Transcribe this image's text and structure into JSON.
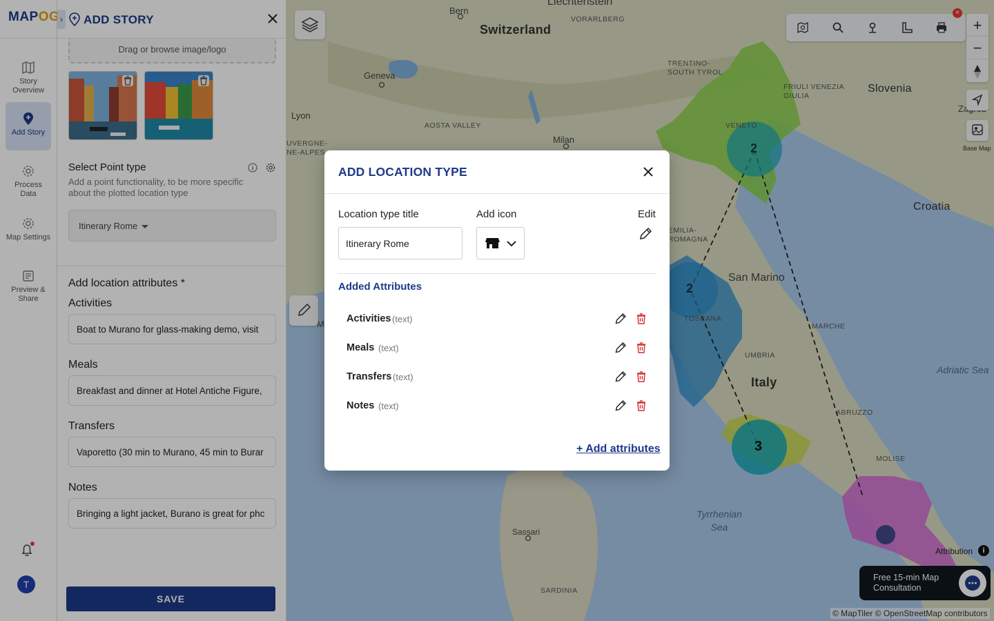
{
  "app": {
    "logo_text_a": "MAP",
    "logo_text_b": "OG"
  },
  "rail": {
    "items": [
      {
        "label": "Story Overview",
        "icon": "map-icon"
      },
      {
        "label": "Add Story",
        "icon": "add-pin-icon",
        "active": true
      },
      {
        "label": "Process Data",
        "icon": "gear-icon"
      },
      {
        "label": "Map Settings",
        "icon": "gear-icon"
      },
      {
        "label": "Preview & Share",
        "icon": "preview-icon"
      }
    ],
    "avatar_initial": "T"
  },
  "panel": {
    "title": "ADD STORY",
    "dropzone_text": "Drag or browse image/logo",
    "point_type_title": "Select Point type",
    "point_type_sub": "Add a point functionality, to be more specific about the plotted location type",
    "point_type_value": "Itinerary Rome",
    "attributes_title": "Add location attributes *",
    "fields": [
      {
        "label": "Activities",
        "value": "Boat to Murano for glass-making demo, visit"
      },
      {
        "label": "Meals",
        "value": "Breakfast and dinner at Hotel Antiche Figure,"
      },
      {
        "label": "Transfers",
        "value": "Vaporetto (30 min to Murano, 45 min to Burar"
      },
      {
        "label": "Notes",
        "value": "Bringing a light jacket, Burano is great for phc"
      }
    ],
    "save_label": "SAVE"
  },
  "map": {
    "places": {
      "bern": "Bern",
      "switzerland": "Switzerland",
      "liechtenstein": "Liechtenstein",
      "vorarlberg": "VORARLBERG",
      "geneva": "Geneva",
      "lyon": "Lyon",
      "auvergne": "UVERGNE-\nNE-ALPES",
      "aosta": "AOSTA VALLEY",
      "milan": "Milan",
      "trentino": "TRENTINO-\nSOUTH TYROL",
      "friuli": "FRIULI VENEZIA\nGIULIA",
      "veneto": "VENETO",
      "slovenia": "Slovenia",
      "zagreb": "Zagreb",
      "croatia": "Croatia",
      "emilia": "EMILIA-\nROMAGNA",
      "san_marino": "San Marino",
      "marche": "MARCHE",
      "toscana": "TOSCANA",
      "umbria": "UMBRIA",
      "italy": "Italy",
      "adriatic": "Adriatic Sea",
      "abruzzo": "ABRUZZO",
      "molise": "MOLISE",
      "tyrrhenian": "Tyrrhenian\nSea",
      "sassari": "Sassari",
      "sardinia": "SARDINIA",
      "ma": "M"
    },
    "clusters": [
      "2",
      "2",
      "3"
    ],
    "base_map_label": "Base Map",
    "attribution_label": "Attribution",
    "consult_text": "Free 15-min Map Consultation",
    "copyright": "© MapTiler © OpenStreetMap contributors",
    "colors": {
      "veneto": "#8bd14a",
      "toscana": "#2b8ccb",
      "lazio": "#c8d64a",
      "campania": "#d46ad4",
      "cluster": "#18a8b8"
    }
  },
  "modal": {
    "title": "ADD LOCATION TYPE",
    "title_label": "Location type title",
    "title_value": "Itinerary Rome",
    "icon_label": "Add icon",
    "edit_label": "Edit",
    "added_title": "Added Attributes",
    "attributes": [
      {
        "name": "Activities",
        "type": "(text)"
      },
      {
        "name": "Meals",
        "type": "(text)"
      },
      {
        "name": "Transfers",
        "type": "(text)"
      },
      {
        "name": "Notes",
        "type": "(text)"
      }
    ],
    "add_label": "+ Add attributes"
  }
}
